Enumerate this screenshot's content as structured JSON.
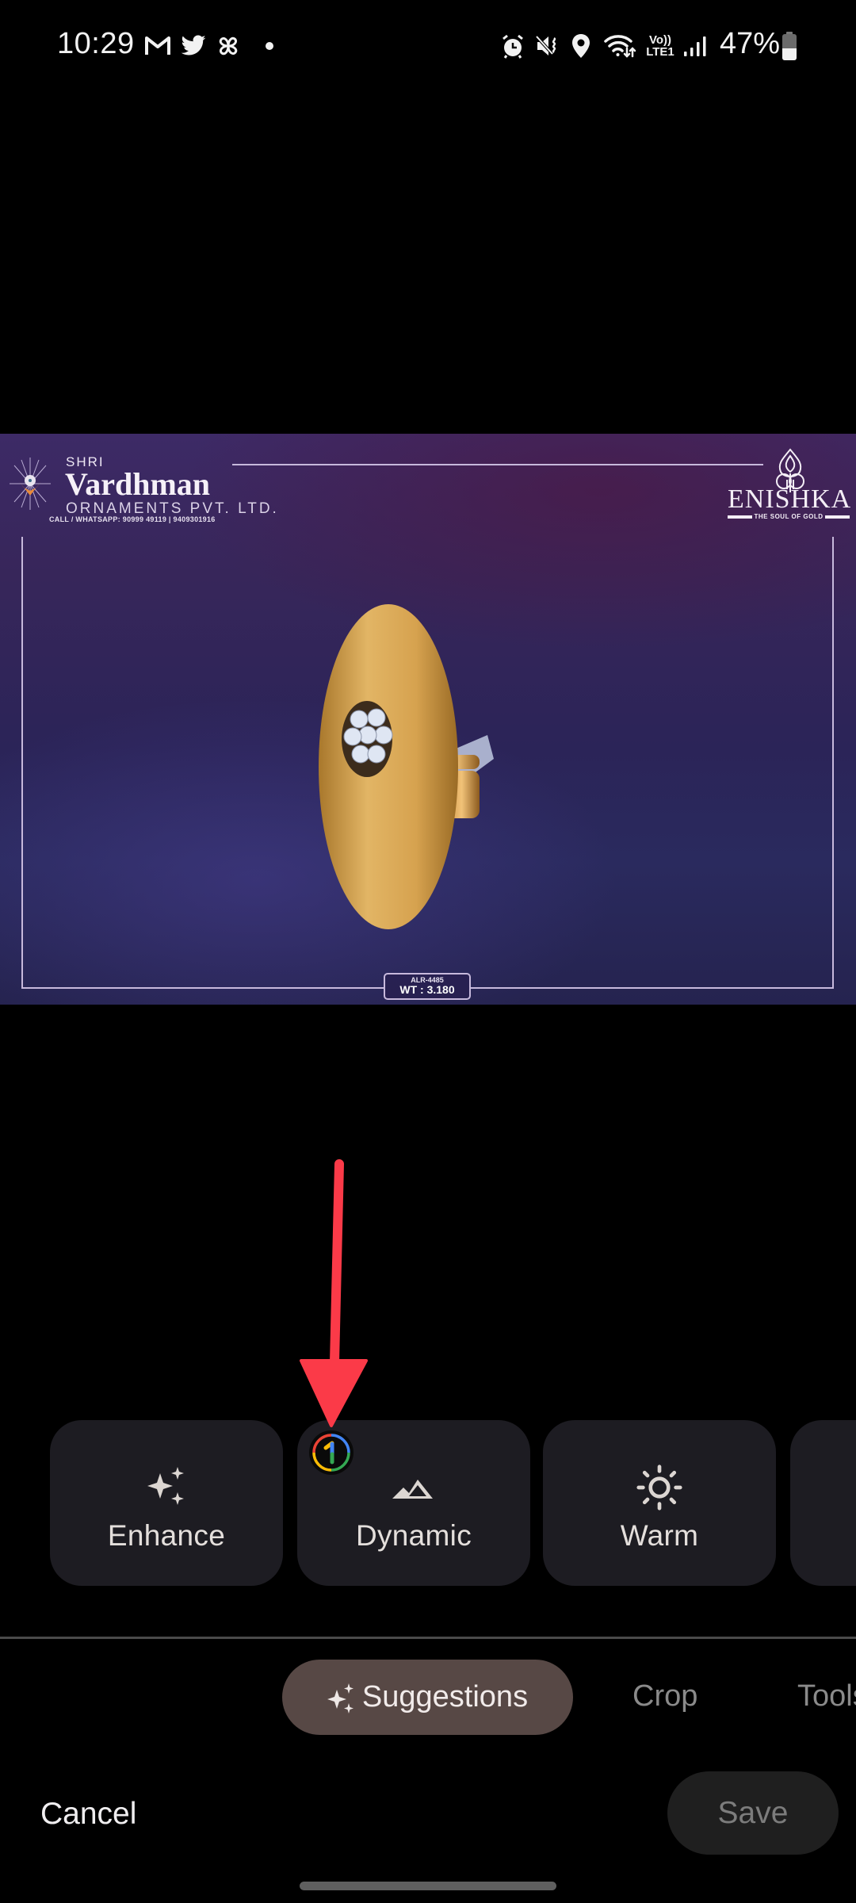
{
  "status_bar": {
    "time": "10:29",
    "notification_icons": [
      "gmail-icon",
      "twitter-icon",
      "pinwheel-icon",
      "more-dot-icon"
    ],
    "system_icons": [
      "alarm-icon",
      "mute-vibrate-icon",
      "location-icon",
      "wifi-icon",
      "volte-icon",
      "signal-icon"
    ],
    "volte_top": "Vo))",
    "volte_bottom": "LTE1",
    "battery_percent": "47%",
    "battery_level": 0.47
  },
  "photo": {
    "brand_left": {
      "prefix": "SHRI",
      "name": "Vardhman",
      "subtitle": "ORNAMENTS PVT. LTD.",
      "contact": "CALL / WHATSAPP: 90999 49119 | 9409301916"
    },
    "brand_right": {
      "name": "ENISHKA",
      "tagline": "THE SOUL OF GOLD"
    },
    "product_code": "ALR-4485",
    "product_weight": "WT : 3.180"
  },
  "annotation": {
    "arrow_color": "#fb3a48",
    "points_to": "Dynamic"
  },
  "suggestions": {
    "cards": [
      {
        "label": "Enhance",
        "icon": "sparkles-icon"
      },
      {
        "label": "Dynamic",
        "icon": "mountain-icon",
        "badge": "google-one-icon"
      },
      {
        "label": "Warm",
        "icon": "sun-icon"
      },
      {
        "label": "",
        "icon": ""
      }
    ]
  },
  "tabs": {
    "items": [
      {
        "label": "Suggestions",
        "active": true,
        "icon": "sparkles-icon"
      },
      {
        "label": "Crop",
        "active": false
      },
      {
        "label": "Tools",
        "active": false
      }
    ]
  },
  "actions": {
    "cancel_label": "Cancel",
    "save_label": "Save"
  },
  "colors": {
    "background": "#000000",
    "card": "#1d1c22",
    "active_tab": "#574845",
    "save_button": "#1f1f1f"
  }
}
